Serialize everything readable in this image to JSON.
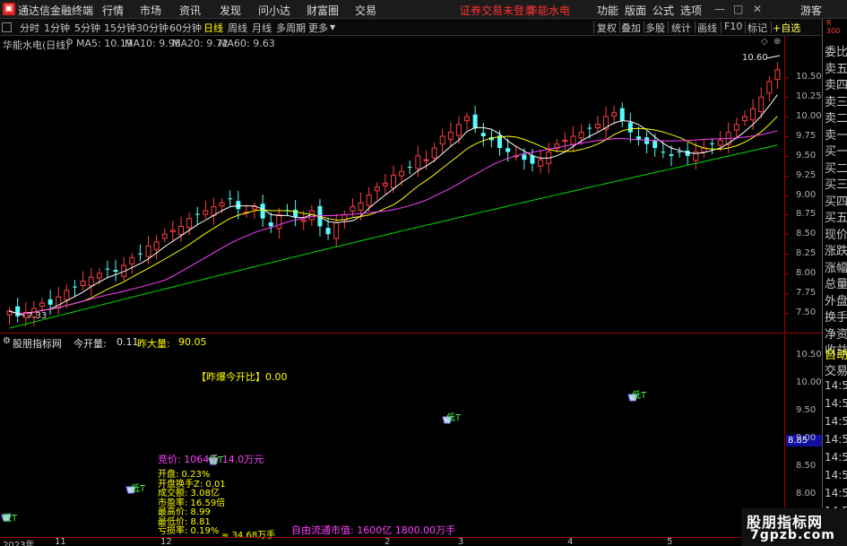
{
  "titlebar": {
    "app_title": "通达信金融终端",
    "menus": [
      "行情",
      "市场",
      "资讯",
      "发现",
      "问小达",
      "财富圈",
      "交易"
    ],
    "warning": "证券交易未登录",
    "stock": "华能水电",
    "right_menus": [
      "功能",
      "版面",
      "公式",
      "选项"
    ],
    "guest": "游客"
  },
  "toolbar": {
    "periods": [
      "分时",
      "1分钟",
      "5分钟",
      "15分钟",
      "30分钟",
      "60分钟",
      "日线",
      "周线",
      "月线",
      "多周期",
      "更多"
    ],
    "active_period": "日线",
    "right_buttons": [
      "复权",
      "叠加",
      "多股",
      "统计",
      "画线",
      "F10",
      "标记",
      "+自选"
    ]
  },
  "main_chart": {
    "title": "华能水电(日线)",
    "ma": [
      {
        "label": "MA5: 10.19",
        "color": "#ffffff"
      },
      {
        "label": "MA10: 9.98",
        "color": "#ffff00"
      },
      {
        "label": "MA20: 9.72",
        "color": "#ff40ff"
      },
      {
        "label": "MA60: 9.63",
        "color": "#00e000"
      }
    ],
    "high_label": "10.60",
    "low_label": "7.33",
    "y_ticks": [
      "10.50",
      "10.25",
      "10.00",
      "9.75",
      "9.50",
      "9.25",
      "9.00",
      "8.75",
      "8.50",
      "8.25",
      "8.00",
      "7.75",
      "7.50"
    ]
  },
  "lower_chart": {
    "title": "股朋指标网",
    "today_label": "今开量:",
    "today_value": "0.11",
    "yesterday_label": "昨大量:",
    "yesterday_value": "90.05",
    "ratio_text": "【昨爆今开比】0.00",
    "price_line": "竞价: 1064手   14.0万元",
    "stats": [
      "开盘: 0.23%",
      "开盘换手Z: 0.01",
      "成交额: 3.08亿",
      "市盈率: 16.59倍",
      "最高价: 8.99",
      "最低价: 8.81",
      "亏损率: 0.19%"
    ],
    "overlay_text": "≈ 34.68万手",
    "bottom_text": "自由流通市值: 1600亿    1800.00万手",
    "markers": [
      "低T",
      "低T",
      "低T",
      "低T",
      "低T"
    ],
    "y_ticks": [
      "10.50",
      "10.00",
      "9.50",
      "9.00",
      "8.50",
      "8.00"
    ],
    "price_tag": "8.85"
  },
  "date_axis": {
    "labels": [
      "2023年",
      "11",
      "12",
      "2",
      "3",
      "4",
      "5"
    ]
  },
  "side_panel": {
    "top": "R 300",
    "items": [
      "委比",
      "卖五",
      "卖四",
      "卖三",
      "卖二",
      "卖一",
      "买一",
      "买二",
      "买三",
      "买四",
      "买五",
      "现价",
      "涨跌",
      "涨幅",
      "总量",
      "外盘",
      "换手",
      "净资",
      "收益"
    ],
    "auto": "自动",
    "trade": "交易",
    "times": [
      "14:56",
      "14:56",
      "14:56",
      "14:56",
      "14:56",
      "14:56",
      "14:56",
      "14:56",
      "14:56"
    ]
  },
  "watermark": {
    "line1": "股朋指标网",
    "line2": "7gpzb.com"
  },
  "chart_data": {
    "type": "candlestick",
    "title": "华能水电(日线)",
    "ylim": [
      7.3,
      10.7
    ],
    "closes": [
      7.52,
      7.45,
      7.5,
      7.55,
      7.62,
      7.6,
      7.7,
      7.78,
      7.82,
      7.9,
      7.95,
      8.0,
      8.05,
      8.02,
      8.1,
      8.2,
      8.25,
      8.35,
      8.4,
      8.5,
      8.55,
      8.6,
      8.7,
      8.75,
      8.8,
      8.85,
      8.9,
      8.95,
      8.82,
      8.78,
      8.85,
      8.7,
      8.6,
      8.75,
      8.8,
      8.72,
      8.68,
      8.8,
      8.6,
      8.5,
      8.65,
      8.75,
      8.85,
      8.9,
      9.0,
      9.1,
      9.15,
      9.25,
      9.3,
      9.35,
      9.5,
      9.45,
      9.6,
      9.75,
      9.8,
      9.9,
      10.0,
      9.85,
      9.75,
      9.7,
      9.6,
      9.55,
      9.5,
      9.45,
      9.4,
      9.45,
      9.55,
      9.65,
      9.7,
      9.75,
      9.8,
      9.85,
      9.9,
      10.0,
      10.05,
      9.95,
      9.8,
      9.7,
      9.65,
      9.6,
      9.55,
      9.5,
      9.55,
      9.5,
      9.55,
      9.6,
      9.65,
      9.7,
      9.8,
      9.9,
      10.0,
      10.1,
      10.25,
      10.45,
      10.6
    ],
    "ma5_last": 10.19,
    "ma10_last": 9.98,
    "ma20_last": 9.72,
    "ma60_last": 9.63,
    "low": 7.33,
    "high": 10.6
  }
}
